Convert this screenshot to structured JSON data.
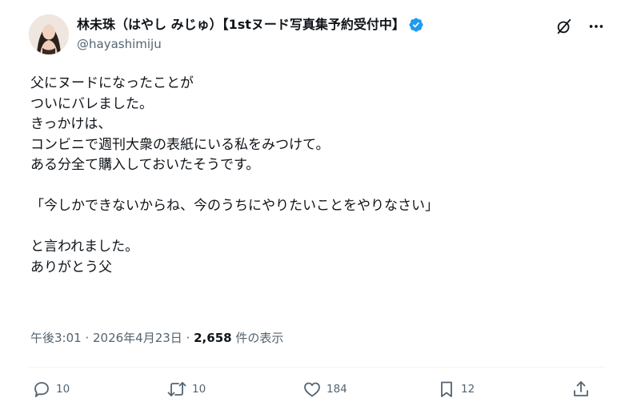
{
  "author": {
    "display_name": "林未珠（はやし みじゅ）【1stヌード写真集予約受付中】",
    "handle": "@hayashimiju",
    "verified_color": "#1d9bf0"
  },
  "header_icons": [
    "grok-icon",
    "more-icon"
  ],
  "post": {
    "text": "父にヌードになったことが\nついにバレました。\nきっかけは、\nコンビニで週刊大衆の表紙にいる私をみつけて。\nある分全て購入しておいたそうです。\n\n「今しかできないからね、今のうちにやりたいことをやりなさい」\n\nと言われました。\nありがとう父"
  },
  "meta": {
    "time": "午後3:01",
    "sep1": " · ",
    "date": "2026年4月23日",
    "sep2": " · ",
    "views_count": "2,658",
    "views_label": " 件の表示"
  },
  "actions": {
    "replies": "10",
    "reposts": "10",
    "likes": "184",
    "bookmarks": "12"
  }
}
